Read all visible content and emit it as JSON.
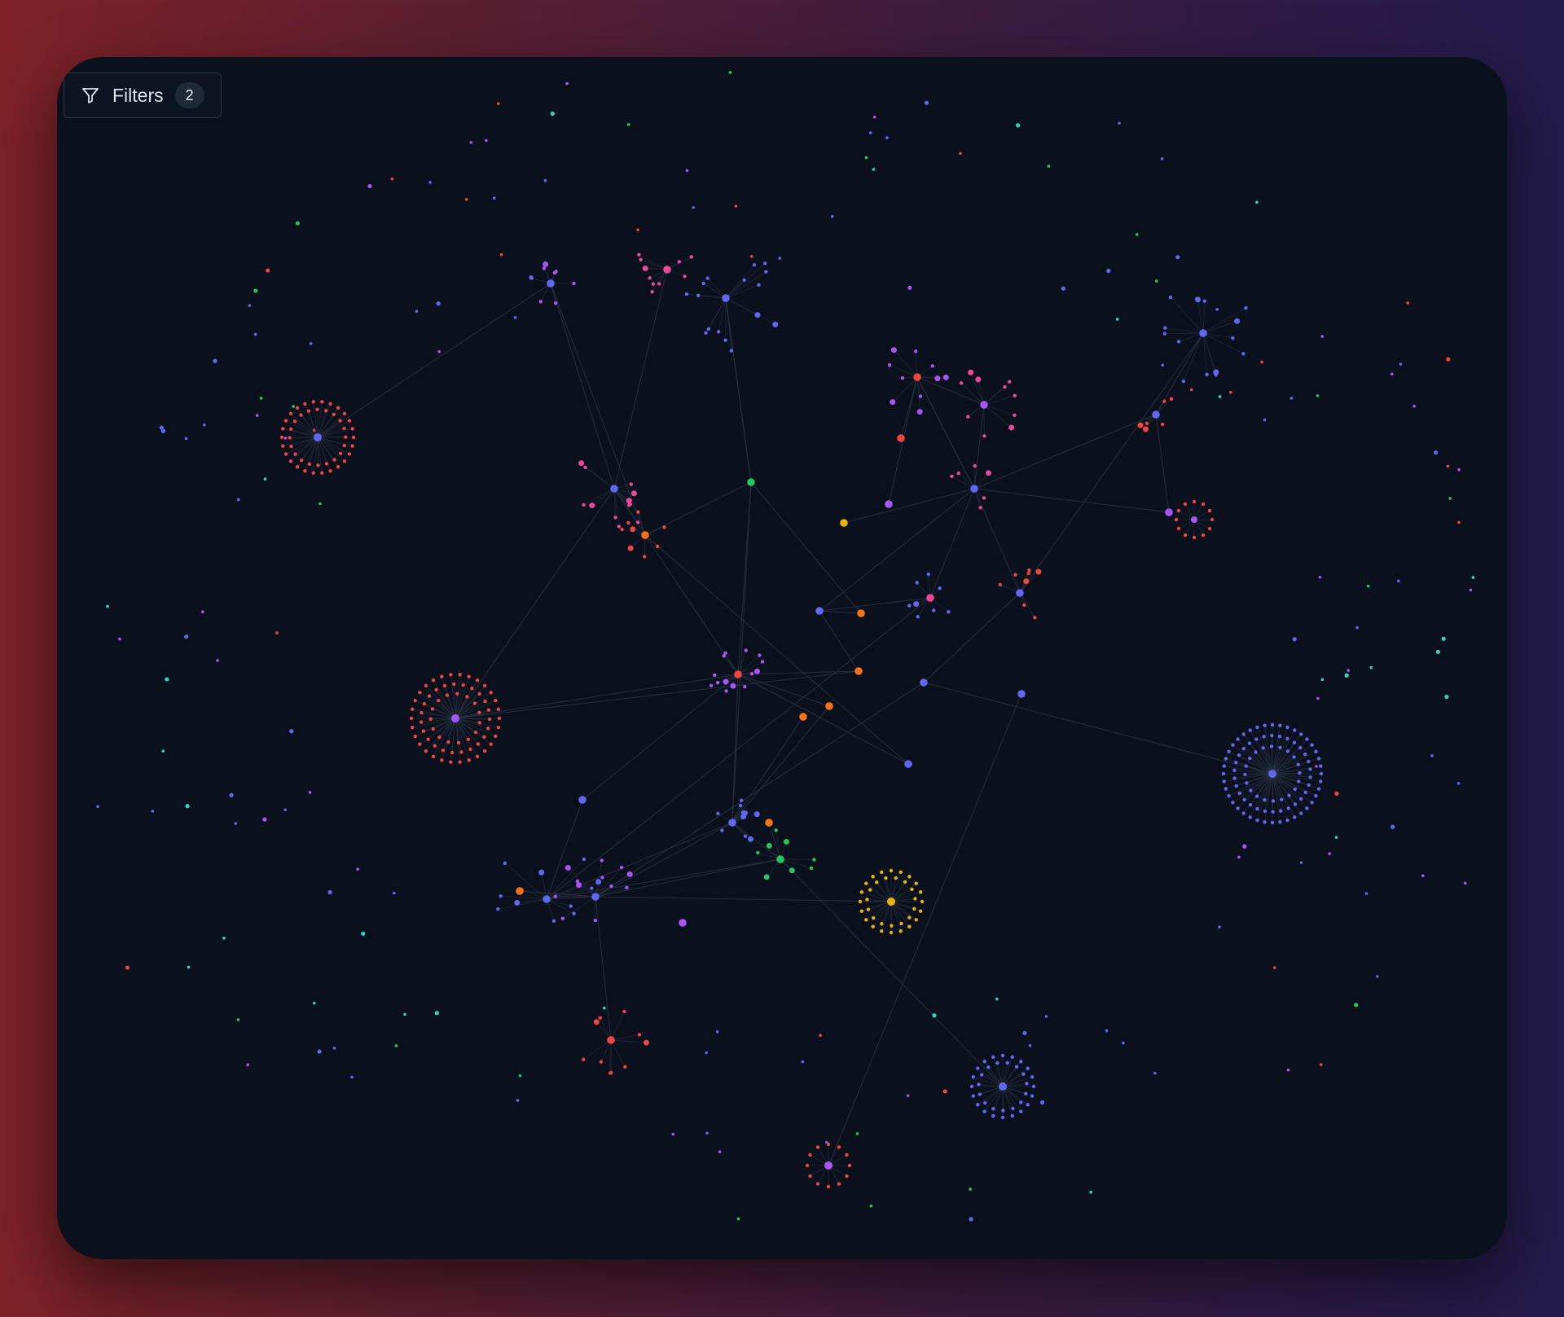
{
  "toolbar": {
    "filter_icon": "filter-icon",
    "filters_label": "Filters",
    "filters_count": "2"
  },
  "graph": {
    "type": "force-directed network graph",
    "link_color": "#2a3446",
    "palette": {
      "blue": "#6366f1",
      "purple": "#a855f7",
      "red": "#ef4444",
      "pink": "#ec4899",
      "orange": "#f97316",
      "yellow": "#eab308",
      "green": "#22c55e",
      "teal": "#2dd4bf"
    }
  }
}
